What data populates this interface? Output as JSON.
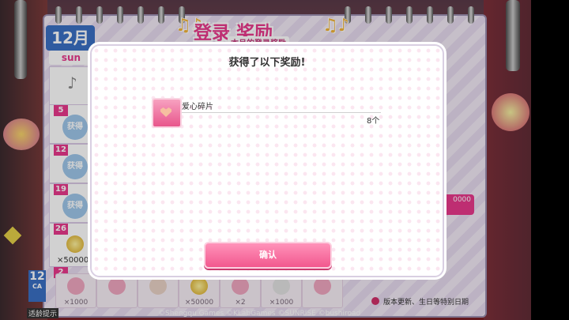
{
  "calendar": {
    "month": "12月",
    "title": "登录 奖励",
    "subtitle": "本月的登录奖励",
    "weekday": "sun",
    "days": [
      {
        "num": "5",
        "stamp": "获得"
      },
      {
        "num": "12",
        "stamp": "获得"
      },
      {
        "num": "19",
        "stamp": "获得"
      },
      {
        "num": "26",
        "stamp": ""
      }
    ],
    "day26_reward": "×50000",
    "bottom_rewards": [
      "×1000",
      "",
      "",
      "×50000",
      "×2",
      "×1000",
      ""
    ],
    "legend": "版本更新、生日等特别日期",
    "copyright": "©Shengqu Games ©KLabGames ©SUNRISE ©bushiroad",
    "left_badge": "12",
    "left_badge_sub": "CA",
    "tip": "适龄提示",
    "right_strip_value": "0000",
    "week_row2": "2"
  },
  "dialog": {
    "title": "获得了以下奖励!",
    "item": {
      "name": "爱心碎片",
      "count": "8个",
      "icon": "heart-fragment-icon"
    },
    "confirm_label": "确认"
  },
  "colors": {
    "accent": "#e8398c",
    "confirm": "#f2588e",
    "month_badge": "#3a6fc4"
  }
}
